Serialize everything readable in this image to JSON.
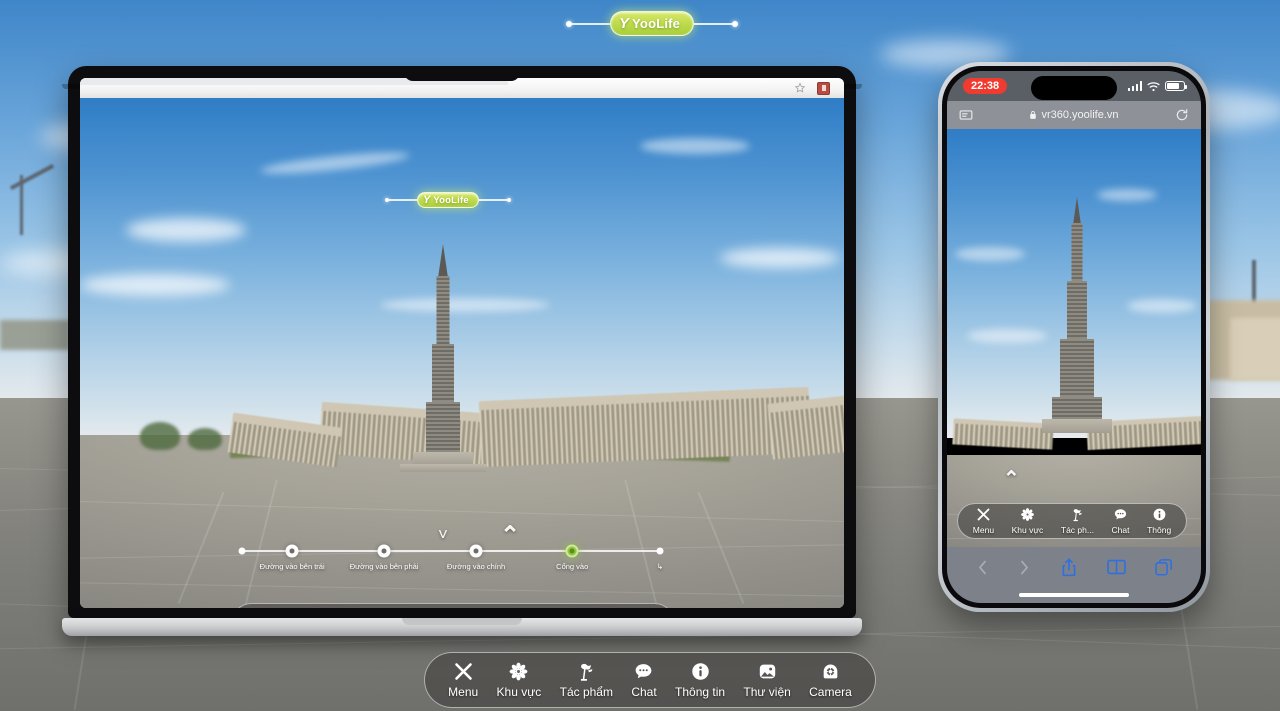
{
  "brand": {
    "logo_mark": "Y",
    "logo_text": "YooLife"
  },
  "scene": {
    "description": "VR360 panorama of a monumental plaza with a tall stepped tower and colonnaded building"
  },
  "laptop": {
    "browser": {
      "bookmark_icon": "star-icon",
      "extension_icon": "extension-badge-icon"
    },
    "badge": {
      "mark": "Y",
      "text": "YooLife"
    },
    "timeline": {
      "chevron_down": "˅",
      "chevron_up": "⌃",
      "nodes": [
        {
          "label": "Đường vào bên trái",
          "position_pct": 12,
          "active": false
        },
        {
          "label": "Đường vào bên phải",
          "position_pct": 34,
          "active": false
        },
        {
          "label": "Đường vào chính",
          "position_pct": 56,
          "active": false
        },
        {
          "label": "Cổng vào",
          "position_pct": 79,
          "active": true
        }
      ],
      "end_label": "↳"
    },
    "menubar": {
      "items": [
        {
          "label": "Menu",
          "icon": "close-x-icon"
        },
        {
          "label": "Khu vực",
          "icon": "compass-flower-icon"
        },
        {
          "label": "Tác phẩm",
          "icon": "statue-icon"
        },
        {
          "label": "Chat",
          "icon": "chat-bubble-icon"
        },
        {
          "label": "Thông tin",
          "icon": "info-circle-icon"
        },
        {
          "label": "Thư viện",
          "icon": "photo-gallery-icon"
        },
        {
          "label": "Camera",
          "icon": "camera-dome-icon"
        }
      ]
    }
  },
  "phone": {
    "status": {
      "time": "22:38",
      "signal_icon": "cellular-signal-icon",
      "wifi_icon": "wifi-icon",
      "battery_icon": "battery-icon",
      "battery_level_pct": 72
    },
    "safari": {
      "reader_icon": "reader-view-icon",
      "lock_icon": "lock-icon",
      "url": "vr360.yoolife.vn",
      "reload_icon": "reload-icon",
      "back_icon": "chevron-left-icon",
      "forward_icon": "chevron-right-icon",
      "share_icon": "share-icon",
      "bookmarks_icon": "book-icon",
      "tabs_icon": "tabs-icon"
    },
    "menubar": {
      "items": [
        {
          "label": "Menu",
          "icon": "close-x-icon"
        },
        {
          "label": "Khu vực",
          "icon": "compass-flower-icon"
        },
        {
          "label": "Tác ph...",
          "icon": "statue-icon"
        },
        {
          "label": "Chat",
          "icon": "chat-bubble-icon"
        },
        {
          "label": "Thông",
          "icon": "info-circle-icon"
        }
      ]
    }
  },
  "global_menubar": {
    "items": [
      {
        "label": "Menu",
        "icon": "close-x-icon"
      },
      {
        "label": "Khu vực",
        "icon": "compass-flower-icon"
      },
      {
        "label": "Tác phẩm",
        "icon": "statue-icon"
      },
      {
        "label": "Chat",
        "icon": "chat-bubble-icon"
      },
      {
        "label": "Thông tin",
        "icon": "info-circle-icon"
      },
      {
        "label": "Thư viện",
        "icon": "photo-gallery-icon"
      },
      {
        "label": "Camera",
        "icon": "camera-dome-icon"
      }
    ]
  },
  "top_badge": {
    "mark": "Y",
    "text": "YooLife"
  },
  "colors": {
    "brand_green": "#bcd94a",
    "active_node": "#8fc73f",
    "ios_red": "#ef3b30",
    "safari_blue": "#2f6fe0"
  }
}
